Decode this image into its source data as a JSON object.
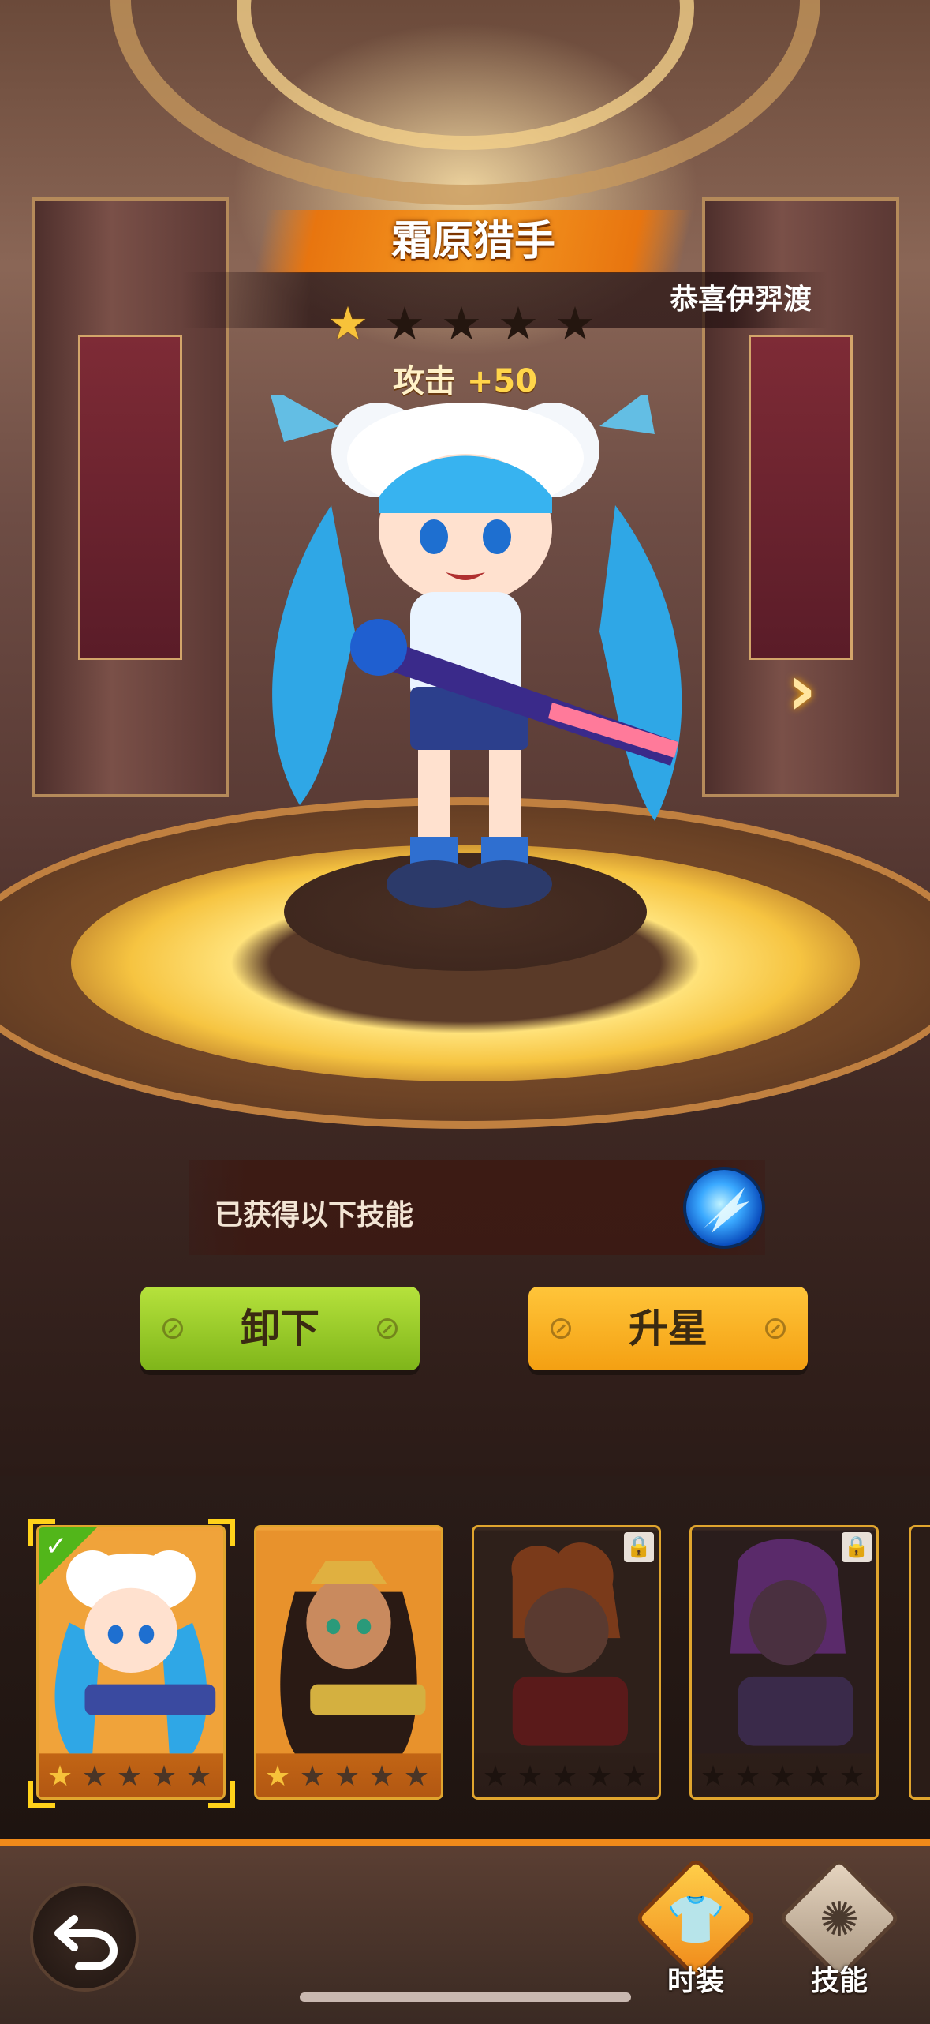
{
  "hero": {
    "name": "霜原猎手",
    "subtitle": "恭喜伊羿渡",
    "stars_filled": 1,
    "stars_total": 5,
    "attack_label": "攻击",
    "attack_value": "+50"
  },
  "skills": {
    "label": "已获得以下技能",
    "icon": "ice-shard-skill-icon"
  },
  "actions": {
    "unequip_label": "卸下",
    "upgrade_label": "升星"
  },
  "roster": [
    {
      "name": "frost-hunter",
      "stars": 1,
      "selected": true,
      "locked": false
    },
    {
      "name": "desert-hunter",
      "stars": 1,
      "selected": false,
      "locked": false
    },
    {
      "name": "flame-hunter",
      "stars": 0,
      "selected": false,
      "locked": true
    },
    {
      "name": "shadow-hunter",
      "stars": 0,
      "selected": false,
      "locked": true
    }
  ],
  "bottom_nav": {
    "costume_label": "时装",
    "skill_label": "技能"
  },
  "colors": {
    "accent_orange": "#f08a1a",
    "unequip_green": "#9fd02a",
    "upgrade_yellow": "#fbb124",
    "star_gold": "#f7c23a"
  }
}
